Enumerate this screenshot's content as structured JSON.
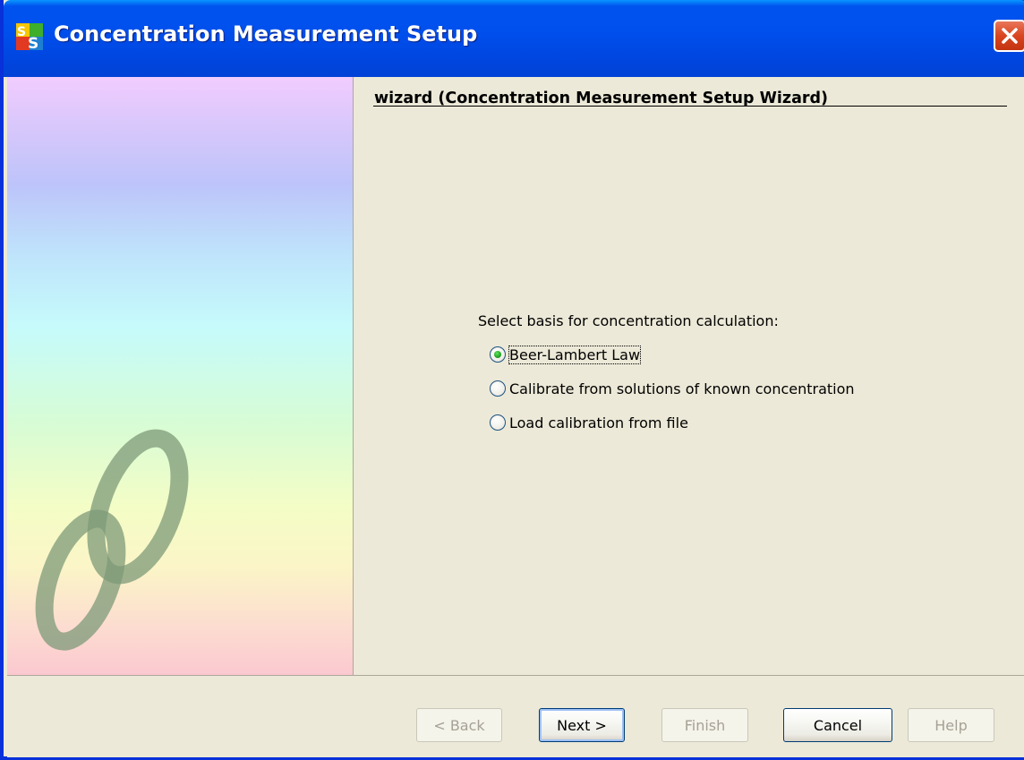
{
  "window": {
    "title": "Concentration Measurement Setup",
    "app_icon": "SS-logo-icon",
    "close_icon": "close-icon"
  },
  "wizard": {
    "heading": "wizard (Concentration Measurement Setup Wizard)",
    "prompt": "Select basis for concentration calculation:",
    "options": [
      {
        "label": "Beer-Lambert Law",
        "selected": true
      },
      {
        "label": "Calibrate from solutions of known concentration",
        "selected": false
      },
      {
        "label": "Load calibration from file",
        "selected": false
      }
    ]
  },
  "buttons": {
    "back": "< Back",
    "next": "Next >",
    "finish": "Finish",
    "cancel": "Cancel",
    "help": "Help"
  },
  "colors": {
    "titlebar": "#0053ee",
    "dialog_bg": "#ece9d8",
    "close_button": "#d9451f"
  }
}
